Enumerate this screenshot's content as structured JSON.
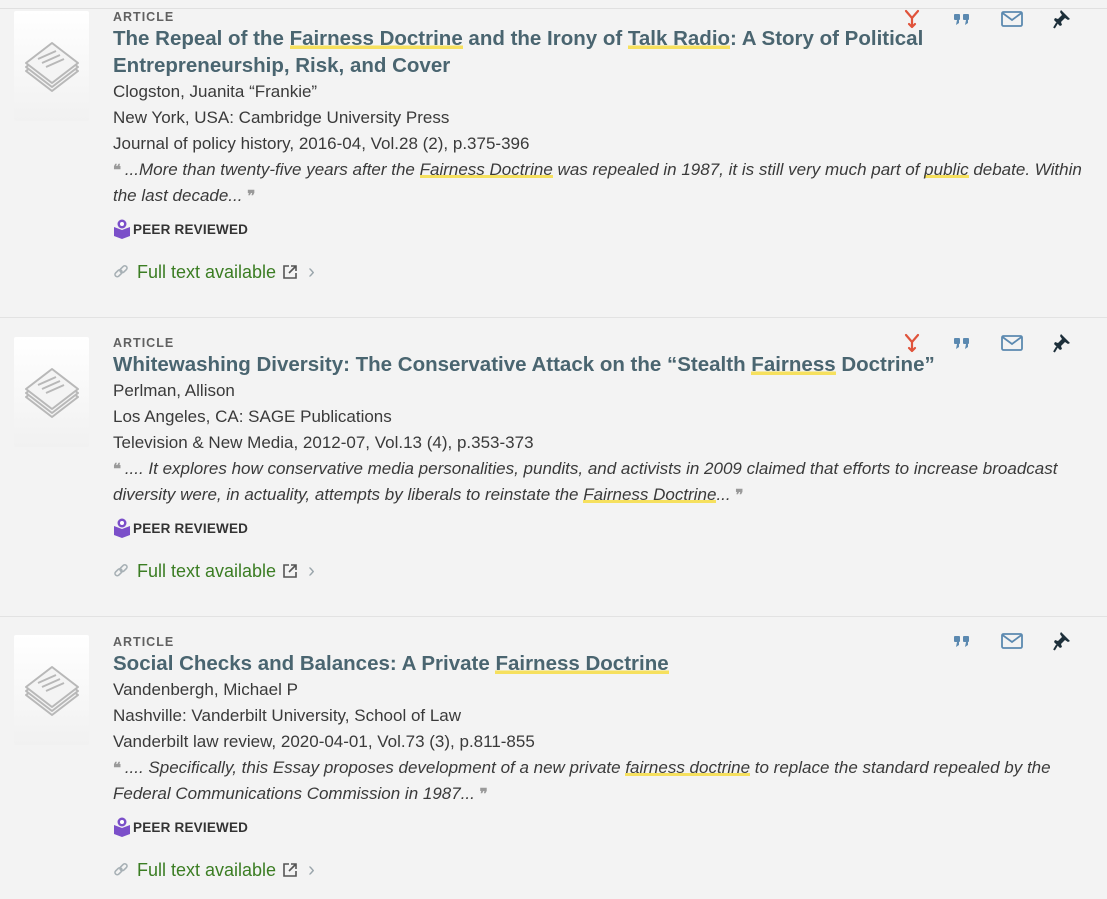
{
  "results": [
    {
      "type": "ARTICLE",
      "title_parts": [
        "The Repeal of the ",
        "Fairness Doctrine",
        " and the Irony of ",
        "Talk Radio",
        ": A Story of Political Entrepreneurship, Risk, and Cover"
      ],
      "author": "Clogston, Juanita “Frankie”",
      "publisher": "New York, USA: Cambridge University Press",
      "source": "Journal of policy history, 2016-04, Vol.28 (2), p.375-396",
      "snippet_parts": [
        "...More than twenty-five years after the ",
        "Fairness Doctrine",
        " was repealed in 1987, it is still very much part of ",
        "public",
        " debate. Within the last decade..."
      ],
      "peer_label": "PEER REVIEWED",
      "fulltext_label": "Full text available",
      "has_citation_trail": true
    },
    {
      "type": "ARTICLE",
      "title_parts": [
        "Whitewashing Diversity: The Conservative Attack on the “Stealth ",
        "Fairness",
        " Doctrine”"
      ],
      "author": "Perlman, Allison",
      "publisher": "Los Angeles, CA: SAGE Publications",
      "source": "Television & New Media, 2012-07, Vol.13 (4), p.353-373",
      "snippet_parts": [
        ".... It explores how conservative media personalities, pundits, and activists in 2009 claimed that efforts to increase broadcast diversity were, in actuality, attempts by liberals to reinstate the ",
        "Fairness Doctrine",
        "..."
      ],
      "peer_label": "PEER REVIEWED",
      "fulltext_label": "Full text available",
      "has_citation_trail": true
    },
    {
      "type": "ARTICLE",
      "title_parts": [
        "Social Checks and Balances: A Private ",
        "Fairness Doctrine",
        ""
      ],
      "author": "Vandenbergh, Michael P",
      "publisher": "Nashville: Vanderbilt University, School of Law",
      "source": "Vanderbilt law review, 2020-04-01, Vol.73 (3), p.811-855",
      "snippet_parts": [
        ".... Specifically, this Essay proposes development of a new private ",
        "fairness doctrine",
        " to replace the standard repealed by the Federal Communications Commission in 1987..."
      ],
      "peer_label": "PEER REVIEWED",
      "fulltext_label": "Full text available",
      "has_citation_trail": false
    }
  ],
  "icons": {
    "citation_trail": "citation-trail-icon",
    "cite": "cite-icon",
    "email": "email-icon",
    "pin": "pin-icon",
    "peer": "peer-reviewed-icon",
    "link": "link-icon",
    "external": "external-link-icon",
    "chevron": "chevron-right-icon"
  },
  "colors": {
    "title": "#4a6570",
    "fulltext": "#3b7d23",
    "highlight": "#f6e05e",
    "peer_badge": "#7b4fc9",
    "citation_trail": "#e0533b",
    "action_icons": "#5b89b0"
  }
}
